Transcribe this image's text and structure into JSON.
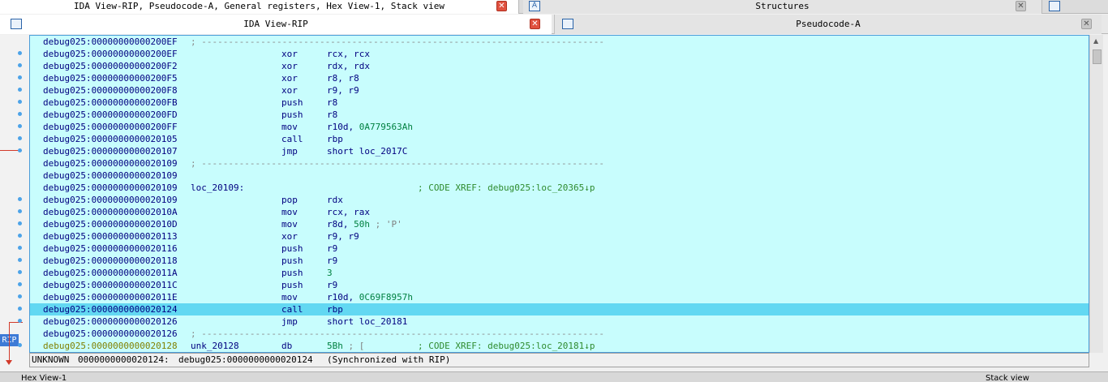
{
  "top_tabs": [
    {
      "label": "IDA View-RIP, Pseudocode-A, General registers, Hex View-1, Stack view"
    },
    {
      "icon": "A",
      "label": "Structures"
    }
  ],
  "sub_tabs": [
    {
      "label": "IDA View-RIP"
    },
    {
      "label": "Pseudocode-A"
    }
  ],
  "close_glyph": "✕",
  "gutter": {
    "rip_label": "RIP"
  },
  "code": {
    "lines": [
      {
        "type": "sep",
        "addr": "debug025:00000000000200EF",
        "text": "; ---------------------------------------------------------------------------"
      },
      {
        "type": "ins",
        "addr": "debug025:00000000000200EF",
        "mn": "xor",
        "op": "rcx, rcx"
      },
      {
        "type": "ins",
        "addr": "debug025:00000000000200F2",
        "mn": "xor",
        "op": "rdx, rdx"
      },
      {
        "type": "ins",
        "addr": "debug025:00000000000200F5",
        "mn": "xor",
        "op": "r8, r8"
      },
      {
        "type": "ins",
        "addr": "debug025:00000000000200F8",
        "mn": "xor",
        "op": "r9, r9"
      },
      {
        "type": "ins",
        "addr": "debug025:00000000000200FB",
        "mn": "push",
        "op": "r8"
      },
      {
        "type": "ins",
        "addr": "debug025:00000000000200FD",
        "mn": "push",
        "op": "r8"
      },
      {
        "type": "ins",
        "addr": "debug025:00000000000200FF",
        "mn": "mov",
        "op": "r10d, ",
        "num": "0A779563Ah"
      },
      {
        "type": "ins",
        "addr": "debug025:0000000000020105",
        "mn": "call",
        "op": "rbp"
      },
      {
        "type": "ins",
        "addr": "debug025:0000000000020107",
        "mn": "jmp",
        "op": "short loc_2017C"
      },
      {
        "type": "sep",
        "addr": "debug025:0000000000020109",
        "text": "; ---------------------------------------------------------------------------"
      },
      {
        "type": "blank",
        "addr": "debug025:0000000000020109"
      },
      {
        "type": "label",
        "addr": "debug025:0000000000020109",
        "label": "loc_20109:",
        "comment": "; CODE XREF: debug025:loc_20365↓p"
      },
      {
        "type": "ins",
        "addr": "debug025:0000000000020109",
        "mn": "pop",
        "op": "rdx"
      },
      {
        "type": "ins",
        "addr": "debug025:000000000002010A",
        "mn": "mov",
        "op": "rcx, rax"
      },
      {
        "type": "ins",
        "addr": "debug025:000000000002010D",
        "mn": "mov",
        "op": "r8d, ",
        "num": "50h",
        "str": " ; 'P'"
      },
      {
        "type": "ins",
        "addr": "debug025:0000000000020113",
        "mn": "xor",
        "op": "r9, r9"
      },
      {
        "type": "ins",
        "addr": "debug025:0000000000020116",
        "mn": "push",
        "op": "r9"
      },
      {
        "type": "ins",
        "addr": "debug025:0000000000020118",
        "mn": "push",
        "op": "r9"
      },
      {
        "type": "ins",
        "addr": "debug025:000000000002011A",
        "mn": "push",
        "num": "3"
      },
      {
        "type": "ins",
        "addr": "debug025:000000000002011C",
        "mn": "push",
        "op": "r9"
      },
      {
        "type": "ins",
        "addr": "debug025:000000000002011E",
        "mn": "mov",
        "op": "r10d, ",
        "num": "0C69F8957h"
      },
      {
        "type": "ins",
        "addr": "debug025:0000000000020124",
        "mn": "call",
        "op": "rbp",
        "highlight": true
      },
      {
        "type": "ins",
        "addr": "debug025:0000000000020126",
        "mn": "jmp",
        "op": "short loc_20181"
      },
      {
        "type": "sep",
        "addr": "debug025:0000000000020126",
        "text": "; ---------------------------------------------------------------------------"
      },
      {
        "type": "data",
        "addr": "debug025:0000000000020128",
        "label": "unk_20128",
        "mn": "db",
        "num": "5Bh",
        "str": " ; [",
        "comment": "; CODE XREF: debug025:loc_20181↓p"
      }
    ]
  },
  "status": {
    "segment": "UNKNOWN",
    "offset": "0000000000020124:",
    "location": "debug025:0000000000020124",
    "sync": "(Synchronized with RIP)"
  },
  "bottom_tabs": [
    {
      "label": "Hex View-1"
    },
    {
      "label": "Stack view"
    }
  ],
  "colors": {
    "code_bg": "#c8fdfd",
    "highlight": "#62d8f2",
    "instruction": "#000080",
    "number": "#008040",
    "comment": "#2e8b2e",
    "rip_label": "#3d7ad6",
    "arrow": "#d23a2a",
    "breakpoint_dot": "#4da3e8"
  }
}
